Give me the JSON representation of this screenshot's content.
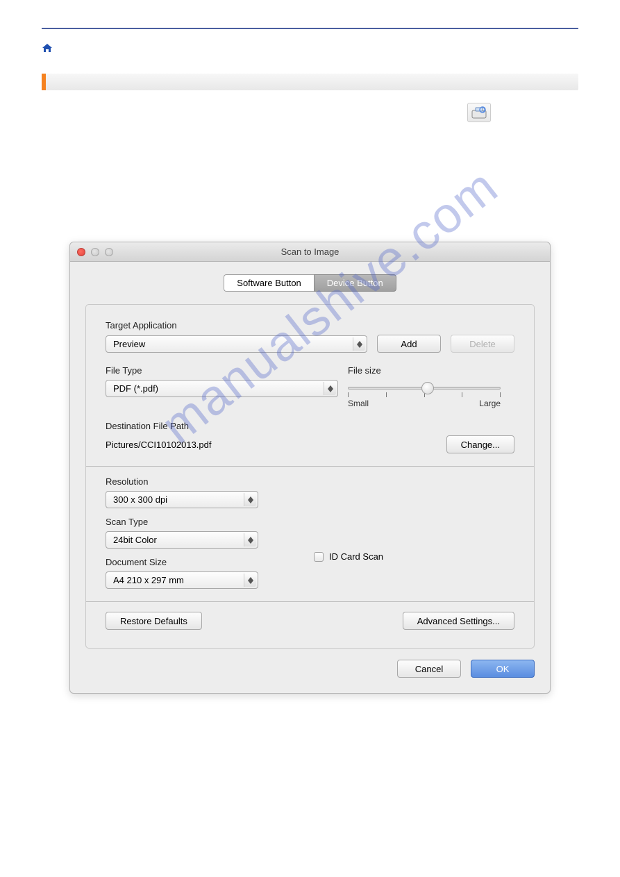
{
  "watermark": "manualshive.com",
  "dialog": {
    "title": "Scan to Image",
    "tabs": {
      "software": "Software Button",
      "device": "Device Button"
    },
    "target_app": {
      "label": "Target Application",
      "value": "Preview",
      "add": "Add",
      "delete": "Delete"
    },
    "file_type": {
      "label": "File Type",
      "value": "PDF (*.pdf)"
    },
    "file_size": {
      "label": "File size",
      "small": "Small",
      "large": "Large"
    },
    "dest_path": {
      "label": "Destination File Path",
      "value": "Pictures/CCI10102013.pdf",
      "change": "Change..."
    },
    "resolution": {
      "label": "Resolution",
      "value": "300 x 300 dpi"
    },
    "scan_type": {
      "label": "Scan Type",
      "value": "24bit Color"
    },
    "doc_size": {
      "label": "Document Size",
      "value": "A4 210 x 297 mm"
    },
    "id_card": "ID Card Scan",
    "restore": "Restore Defaults",
    "advanced": "Advanced Settings...",
    "cancel": "Cancel",
    "ok": "OK"
  }
}
